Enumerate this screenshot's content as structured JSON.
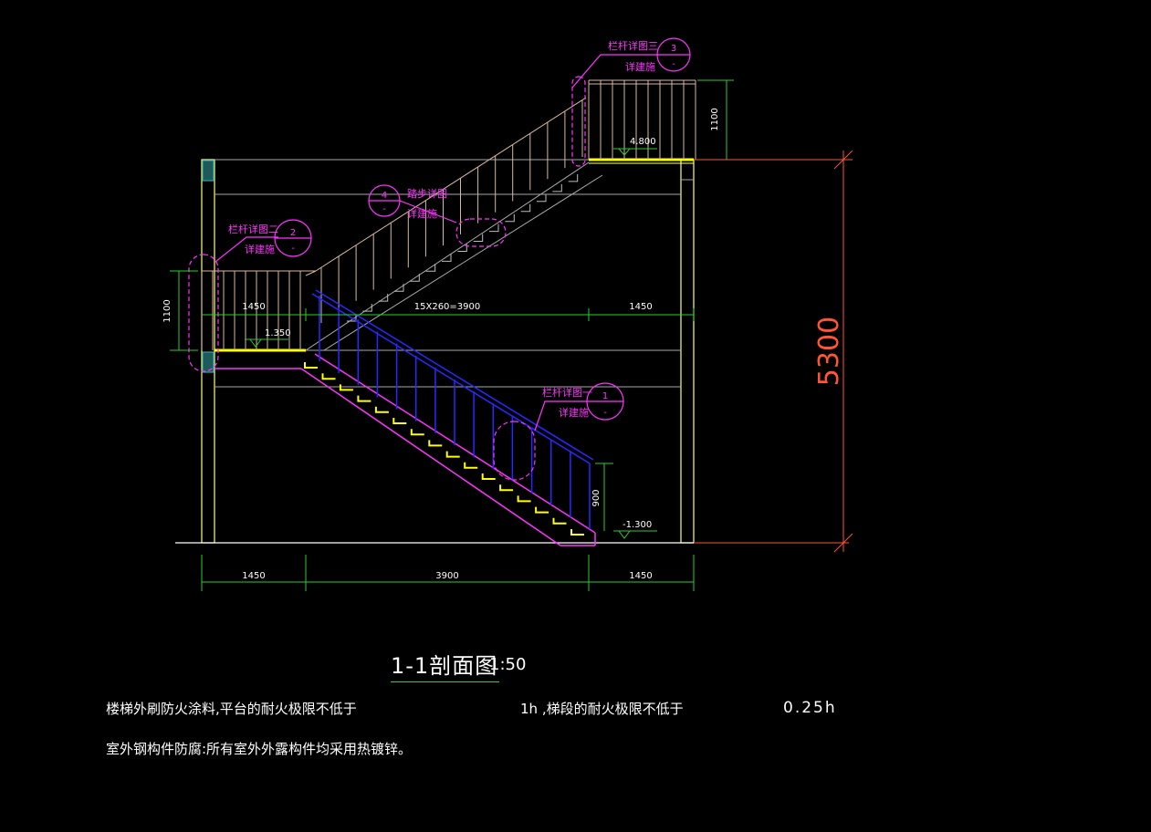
{
  "drawing": {
    "total_height": "5300",
    "dims_bottom": [
      "1450",
      "3900",
      "1450"
    ],
    "dim_stair": "15X260=3900",
    "dim_mid_left": "1450",
    "dim_mid_right": "1450",
    "rail_height_top": "1100",
    "rail_height_mid": "1100",
    "rail_height_low": "900",
    "levels": [
      "4.800",
      "1.350",
      "-1.300"
    ],
    "callouts": [
      {
        "title": "栏杆详图三",
        "sub": "详建施",
        "num": "3"
      },
      {
        "title": "踏步详图",
        "sub": "详建施",
        "num": "4"
      },
      {
        "title": "栏杆详图二",
        "sub": "详建施",
        "num": "2"
      },
      {
        "title": "栏杆详图一",
        "sub": "详建施",
        "num": "1"
      }
    ],
    "callout_dash": "-"
  },
  "title": {
    "label": "1-1剖面图",
    "scale": "1:50"
  },
  "notes": {
    "line1_a": "楼梯外刷防火涂料,平台的耐火极限不低于",
    "line1_b": "1h ,梯段的耐火极限不低于",
    "line1_c": "0.25h",
    "line2": "室外钢构件防腐:所有室外外露构件均采用热镀锌。"
  },
  "colors": {
    "background": "#000000",
    "structure": "#ffff80",
    "dimension": "#2ecc2e",
    "rail_upper": "#d7b8a0",
    "rail_lower": "#2828ff",
    "annotation": "#ff33ff",
    "big_dim": "#ff5533",
    "steps": "#ffff00",
    "grey_line": "#a8a8a8"
  }
}
